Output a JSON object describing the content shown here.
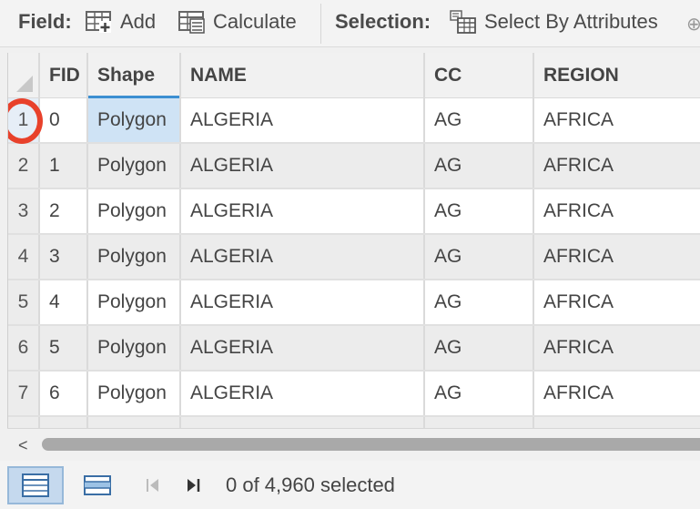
{
  "toolbar": {
    "field_label": "Field:",
    "add_label": "Add",
    "calculate_label": "Calculate",
    "selection_label": "Selection:",
    "select_by_attributes_label": "Select By Attributes"
  },
  "table": {
    "columns": [
      "FID",
      "Shape",
      "NAME",
      "CC",
      "REGION"
    ],
    "rows": [
      {
        "row": "1",
        "fid": "0",
        "shape": "Polygon",
        "name": "ALGERIA",
        "cc": "AG",
        "region": "AFRICA"
      },
      {
        "row": "2",
        "fid": "1",
        "shape": "Polygon",
        "name": "ALGERIA",
        "cc": "AG",
        "region": "AFRICA"
      },
      {
        "row": "3",
        "fid": "2",
        "shape": "Polygon",
        "name": "ALGERIA",
        "cc": "AG",
        "region": "AFRICA"
      },
      {
        "row": "4",
        "fid": "3",
        "shape": "Polygon",
        "name": "ALGERIA",
        "cc": "AG",
        "region": "AFRICA"
      },
      {
        "row": "5",
        "fid": "4",
        "shape": "Polygon",
        "name": "ALGERIA",
        "cc": "AG",
        "region": "AFRICA"
      },
      {
        "row": "6",
        "fid": "5",
        "shape": "Polygon",
        "name": "ALGERIA",
        "cc": "AG",
        "region": "AFRICA"
      },
      {
        "row": "7",
        "fid": "6",
        "shape": "Polygon",
        "name": "ALGERIA",
        "cc": "AG",
        "region": "AFRICA"
      }
    ]
  },
  "status": {
    "selected_text": "0 of 4,960 selected"
  },
  "colors": {
    "accent": "#3c8fd1",
    "selected_cell": "#cfe3f5",
    "highlight_circle": "#e8412b"
  },
  "icons": [
    "add-field-icon",
    "calculate-field-icon",
    "select-by-attributes-icon",
    "scroll-left-icon",
    "table-view-icon",
    "list-view-icon",
    "first-record-icon",
    "next-record-icon"
  ]
}
